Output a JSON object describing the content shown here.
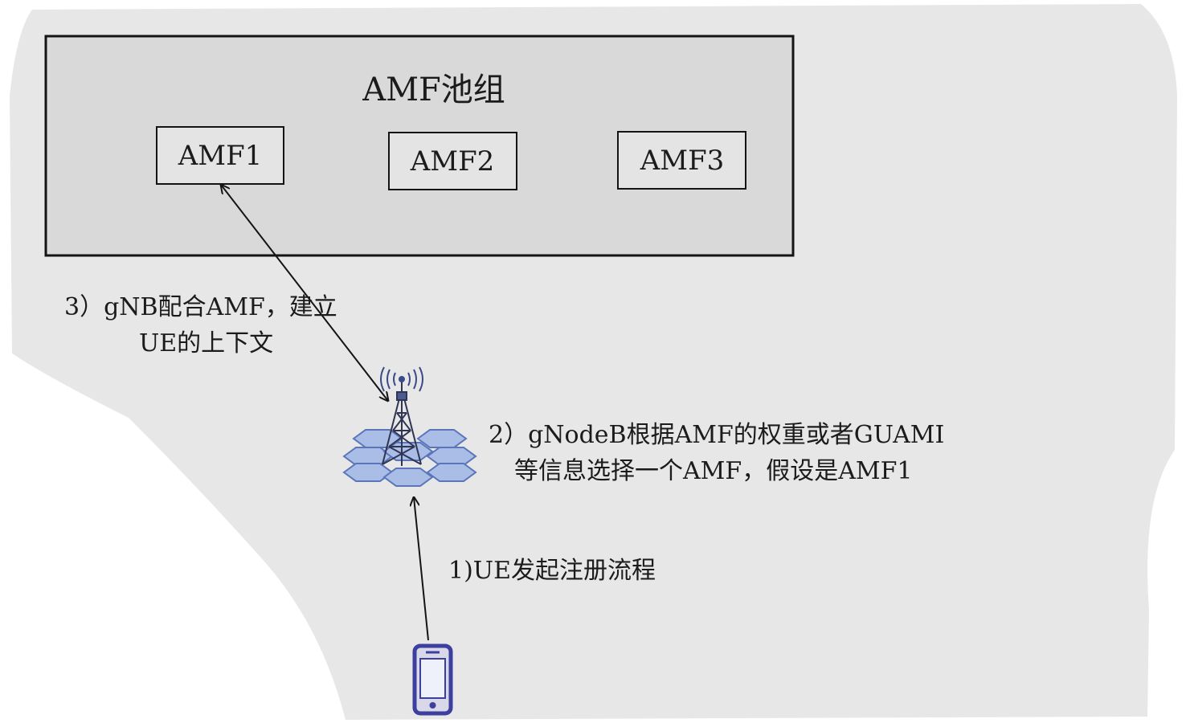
{
  "pool": {
    "title": "AMF池组",
    "members": [
      "AMF1",
      "AMF2",
      "AMF3"
    ]
  },
  "steps": {
    "step1": "1)UE发起注册流程",
    "step2_line1": "2）gNodeB根据AMF的权重或者GUAMI",
    "step2_line2": "等信息选择一个AMF，假设是AMF1",
    "step3_line1": "3）gNB配合AMF，建立",
    "step3_line2": "UE的上下文"
  },
  "icons": {
    "base_station": "gnodeb-tower-icon",
    "phone": "smartphone-icon"
  },
  "colors": {
    "background": "#e7e7e7",
    "pool_box": "#d9d9d9",
    "stroke": "#141414",
    "hex_fill": "#a9bde6",
    "hex_stroke": "#5a75b8",
    "phone": "#3c3f9e"
  }
}
